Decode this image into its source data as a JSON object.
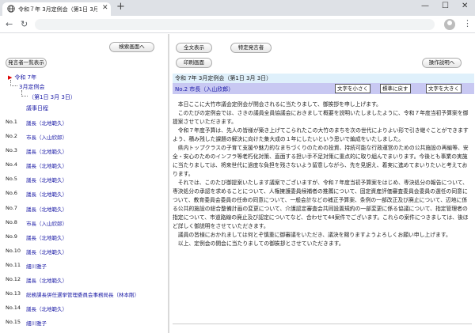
{
  "browser": {
    "tab_title": "令和７年 3月定例会（第1日 3月",
    "new_tab": "+",
    "minimize": "—",
    "maximize": "☐",
    "close": "✕",
    "back": "←",
    "reload": "↻",
    "menu": "⋮"
  },
  "left": {
    "search_screen_btn": "検索画面へ",
    "speaker_list_btn": "発言者一覧表示",
    "tree_root": "令和 7年",
    "tree_session": "3月定例会",
    "tree_day": "（第1日 3月 3日）",
    "agenda": "議事日程",
    "entries": [
      {
        "no": "No.1",
        "speaker": "議長（北地範久）"
      },
      {
        "no": "No.2",
        "speaker": "市長（入山欣郎）"
      },
      {
        "no": "No.3",
        "speaker": "議長（北地範久）"
      },
      {
        "no": "No.4",
        "speaker": "議長（北地範久）"
      },
      {
        "no": "No.5",
        "speaker": "議長（北地範久）"
      },
      {
        "no": "No.6",
        "speaker": "議長（北地範久）"
      },
      {
        "no": "No.7",
        "speaker": "議長（北地範久）"
      },
      {
        "no": "No.8",
        "speaker": "市長（入山欣郎）"
      },
      {
        "no": "No.9",
        "speaker": "議長（北地範久）"
      },
      {
        "no": "No.10",
        "speaker": "議長（北地範久）"
      },
      {
        "no": "No.11",
        "speaker": "細川雅子"
      },
      {
        "no": "No.12",
        "speaker": "議長（北地範久）"
      },
      {
        "no": "No.13",
        "speaker": "総務課長併任選挙管理委員会事務局長（林本剛）"
      },
      {
        "no": "No.14",
        "speaker": "議長（北地範久）"
      },
      {
        "no": "No.15",
        "speaker": "細川雅子"
      }
    ]
  },
  "right": {
    "fulltext_btn": "全文表示",
    "specific_speaker_btn": "特定発言者",
    "print_screen_btn": "印刷画面",
    "help_btn": "操作説明へ",
    "doc_header": "令和 7年 3月定例会（第1日 3月 3日）",
    "speaker_heading": "No.2 市長（入山欣郎）",
    "text_smaller": "文字を小さく",
    "text_default": "標準に戻す",
    "text_larger": "文字を大きく",
    "paragraphs": [
      "本日ここに大竹市議会定例会が開会されるに当たりまして、御挨拶を申し上げます。",
      "このたびの定例会では、さきの議員全員協議会におきまして概要を説明いたしましたように、令和７年度当初予算案を御提案させていただきます。",
      "令和７年度予算は、先人の皆様が築き上げてこられたこの大竹のまちを次の世代によりよい形で引き継ぐことができますよう、積み残した課題の解決に向けた集大成の１年にしたいという思いで編成をいたしました。",
      "県内トップクラスの子育て支援や魅力的なまちづくりのための投資、持続可能な行政運営のための公共施設の再編等、安全・安心のためのインフラ等老朽化対策、直面する担い手不足対策に重点的に取り組んでまいります。今後とも事業の実施に当たりましては、将来世代に過度な負担を残さないよう留意しながら、先を見据え、着実に進めてまいりたいと考えております。",
      "それでは、このたび御提案いたします議案でございますが、令和７年度当初予算案をはじめ、専決処分の報告について、専決処分の承認を求めることについて、人権擁護委員候補者の推薦について、固定資産評価審査委員会委員の選任の同意について、教育委員会委員の任命の同意について、一般会計などの補正予算案、条例の一部改正及び廃止について、辺地に係る公共的施設の総合整備計画の変更について、介護認定審査会共同設置規約の一部変更に係る協議について、指定管理者の指定について、市道路線の廃止及び認定についてなど、合わせて44案件でございます。これらの案件につきましては、後ほど詳しく御説明をさせていただきます。",
      "議員の皆様におかれましては何とぞ慎重に御審議をいただき、議決を賜りますようよろしくお願い申し上げます。",
      "以上、定例会の開会に当たりましての御挨拶とさせていただきます。"
    ]
  }
}
